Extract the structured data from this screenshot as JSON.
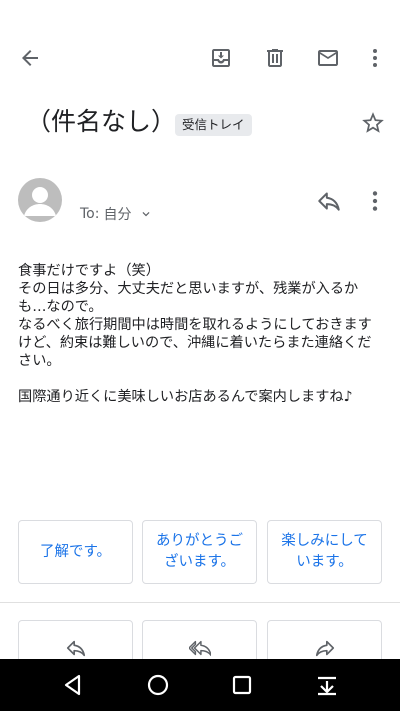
{
  "toolbar": {
    "icons": [
      "back-arrow-icon",
      "archive-icon",
      "trash-icon",
      "mail-icon",
      "more-vert-icon"
    ]
  },
  "message": {
    "subject": "（件名なし）",
    "label": "受信トレイ",
    "to_prefix": "To:",
    "to_name": "自分",
    "body": "食事だけですよ（笑）\nその日は多分、大丈夫だと思いますが、残業が入るかも…なので。\nなるべく旅行期間中は時間を取れるようにしておきますけど、約束は難しいので、沖縄に着いたらまた連絡ください。\n\n国際通り近くに美味しいお店あるんで案内しますね♪"
  },
  "smart_replies": [
    "了解です。",
    "ありがとうございます。",
    "楽しみにしています。"
  ],
  "actions": [
    "reply-icon",
    "reply-all-icon",
    "forward-icon"
  ],
  "navbar": [
    "back-triangle-icon",
    "home-circle-icon",
    "recents-square-icon",
    "notification-pull-icon"
  ],
  "colors": {
    "accent": "#1a73e8",
    "icon": "#5f6368",
    "chip": "#e8eaed",
    "avatar": "#bdbdbd"
  }
}
